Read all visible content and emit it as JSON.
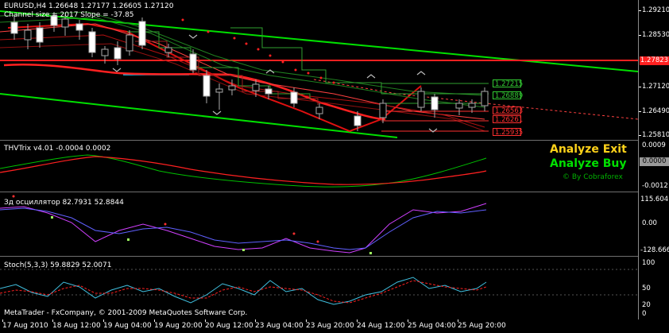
{
  "main_chart": {
    "header": "EURUSD,H4  1.26648 1.27177 1.26605 1.27120",
    "channel_info": "Channel size = 2017 Slope = -37.85",
    "y_ticks": [
      "1.29210",
      "1.28530",
      "1.27120",
      "1.26490",
      "1.25810"
    ],
    "current_price": "1.27823",
    "level_labels": [
      {
        "text": "1.27215",
        "color": "#33cc33"
      },
      {
        "text": "1.26889",
        "color": "#33cc33"
      },
      {
        "text": "1.26563",
        "color": "#ff3030"
      },
      {
        "text": "1.26261",
        "color": "#ff3030"
      },
      {
        "text": "1.25935",
        "color": "#ff3030"
      }
    ],
    "colors": {
      "channel": "#00e000",
      "regression": "#ff2020",
      "support": "#00d0ff",
      "bull_candle": "#ffffff",
      "bear_candle": "#000000"
    }
  },
  "thv_trix": {
    "label": "THVTrix v4.01 -0.0004 0.0002",
    "y_ticks": [
      "0.0009",
      "0.0000",
      "-0.0012"
    ],
    "current_value": "0.0000",
    "signal_exit": "Analyze Exit",
    "signal_buy": "Analyze Buy",
    "credit": "© By Cobraforex",
    "colors": {
      "exit": "#ffd21a",
      "buy": "#00e000",
      "fast": "#00c000",
      "slow": "#ff2020"
    }
  },
  "oscillator": {
    "label": "Зд осциллятор 82.7931 52.8844",
    "y_ticks": [
      "115.6041",
      "0.00",
      "-128.6663"
    ],
    "colors": {
      "line1": "#d040ff",
      "line2": "#6060ff",
      "dots": "#ff3030",
      "dots2": "#a0ff60"
    }
  },
  "stochastic": {
    "label": "Stoch(5,3,3) 59.8829 52.0071",
    "y_ticks": [
      "100",
      "50",
      "20",
      "0"
    ],
    "copyright": "MetaTrader - FxCompany, © 2001-2009 MetaQuotes Software Corp.",
    "colors": {
      "main": "#40c0e0",
      "signal": "#ff2020"
    }
  },
  "x_axis": [
    "17 Aug 2010",
    "18 Aug 12:00",
    "19 Aug 04:00",
    "19 Aug 20:00",
    "20 Aug 12:00",
    "23 Aug 04:00",
    "23 Aug 20:00",
    "24 Aug 12:00",
    "25 Aug 04:00",
    "25 Aug 20:00"
  ]
}
